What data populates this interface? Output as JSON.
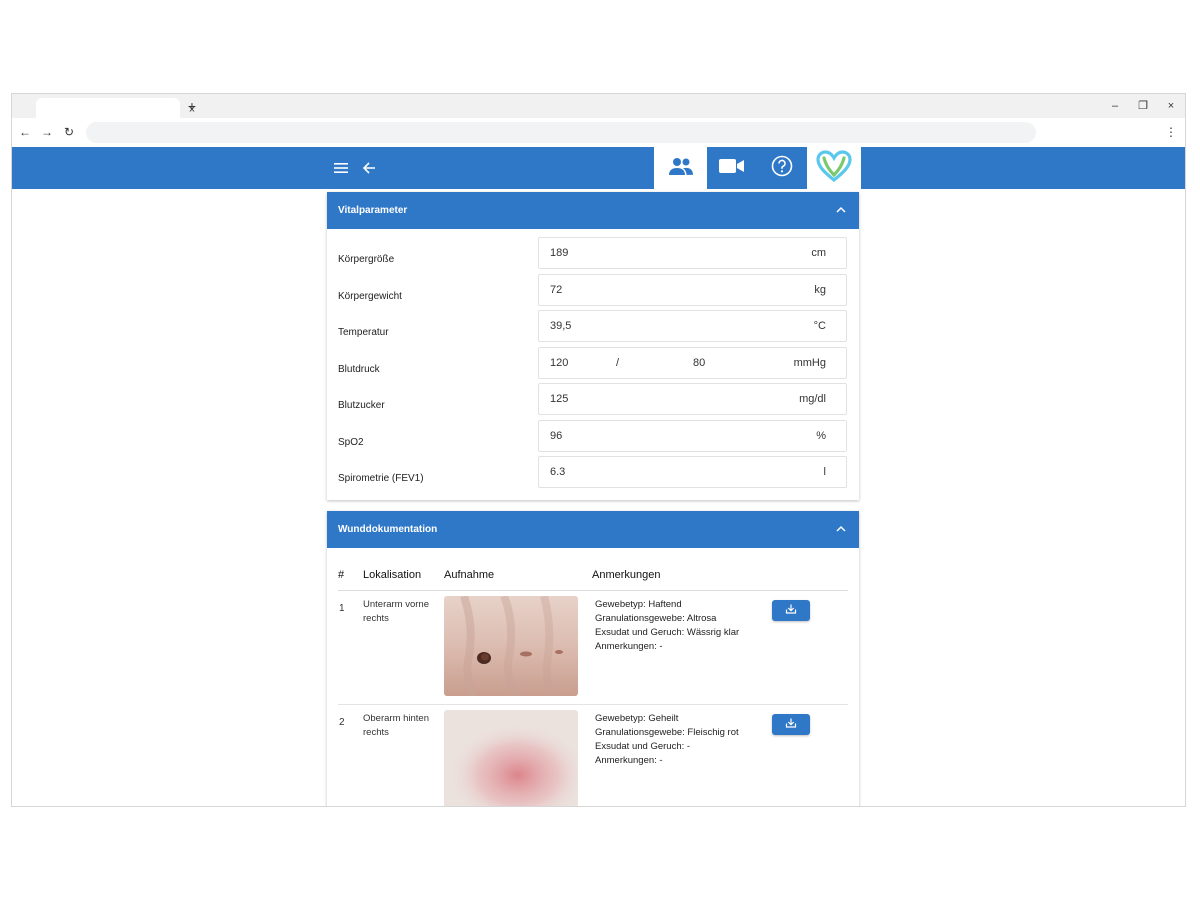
{
  "browser": {
    "tab_close": "×",
    "tab_new": "+",
    "minimize": "–",
    "restore": "❐",
    "close": "×",
    "back": "←",
    "forward": "→",
    "reload": "↻",
    "menu": "⋮",
    "url": ""
  },
  "colors": {
    "primary": "#2f78c8",
    "header_text": "#ffffff"
  },
  "vital": {
    "title": "Vitalparameter",
    "rows": [
      {
        "label": "Körpergröße",
        "value": "189",
        "unit": "cm"
      },
      {
        "label": "Körpergewicht",
        "value": "72",
        "unit": "kg"
      },
      {
        "label": "Temperatur",
        "value": "39,5",
        "unit": "°C"
      },
      {
        "label": "Blutdruck",
        "value": "120",
        "separator": "/",
        "value2": "80",
        "unit": "mmHg"
      },
      {
        "label": "Blutzucker",
        "value": "125",
        "unit": "mg/dl"
      },
      {
        "label": "SpO2",
        "value": "96",
        "unit": "%"
      },
      {
        "label": "Spirometrie (FEV1)",
        "value": "6.3",
        "unit": "l"
      }
    ]
  },
  "wound": {
    "title": "Wunddokumentation",
    "columns": [
      "#",
      "Lokalisation",
      "Aufnahme",
      "Anmerkungen"
    ],
    "rows": [
      {
        "num": "1",
        "location": "Unterarm vorne rechts",
        "notes": [
          "Gewebetyp: Haftend",
          "Granulationsgewebe: Altrosa",
          "Exsudat und Geruch: Wässrig klar",
          "Anmerkungen: -"
        ]
      },
      {
        "num": "2",
        "location": "Oberarm hinten rechts",
        "notes": [
          "Gewebetyp: Geheilt",
          "Granulationsgewebe: Fleischig rot",
          "Exsudat und Geruch: -",
          "Anmerkungen: -"
        ]
      }
    ]
  }
}
